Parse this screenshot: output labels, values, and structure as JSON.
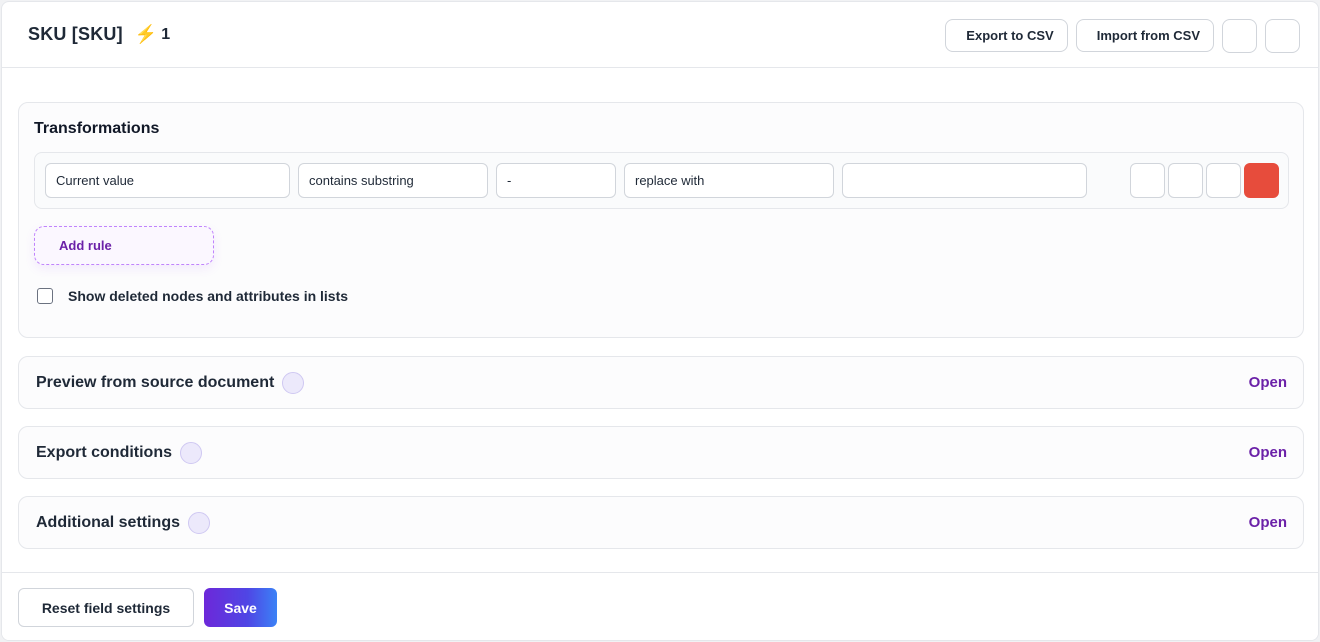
{
  "header": {
    "title": "SKU [SKU]",
    "bolt_icon": "lightning-icon",
    "bolt_count": "1",
    "export_label": "Export to CSV",
    "import_label": "Import from CSV"
  },
  "transformations": {
    "title": "Transformations",
    "rule": {
      "source": "Current value",
      "condition": "contains substring",
      "match_value": "-",
      "action": "replace with",
      "replacement": ""
    },
    "add_rule_label": "Add rule",
    "show_deleted_label": "Show deleted nodes and attributes in lists"
  },
  "sections": [
    {
      "title": "Preview from source document",
      "action": "Open"
    },
    {
      "title": "Export conditions",
      "action": "Open"
    },
    {
      "title": "Additional settings",
      "action": "Open"
    }
  ],
  "footer": {
    "reset_label": "Reset field settings",
    "save_label": "Save"
  },
  "colors": {
    "accent": "#6b21a8",
    "danger": "#e74c3c",
    "save_gradient_start": "#6d28d9",
    "save_gradient_end": "#3b82f6"
  }
}
